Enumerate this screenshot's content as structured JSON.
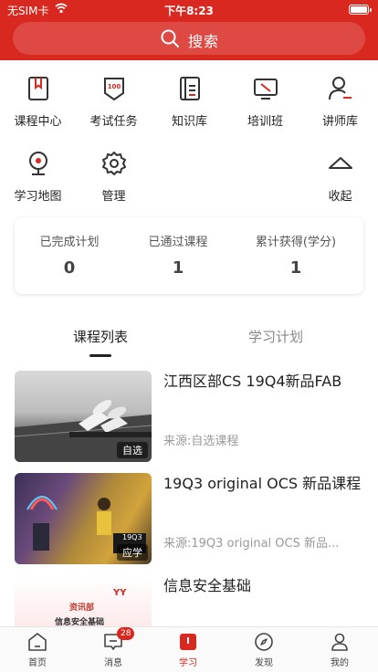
{
  "status_bar": {
    "carrier": "无SIM卡",
    "time": "下午8:23"
  },
  "search": {
    "placeholder": "搜索"
  },
  "menu": [
    {
      "label": "课程中心",
      "icon": "book-icon"
    },
    {
      "label": "考试任务",
      "icon": "exam-badge-icon"
    },
    {
      "label": "知识库",
      "icon": "document-icon"
    },
    {
      "label": "培训班",
      "icon": "monitor-icon"
    },
    {
      "label": "讲师库",
      "icon": "teacher-icon"
    },
    {
      "label": "学习地图",
      "icon": "location-icon"
    },
    {
      "label": "管理",
      "icon": "gear-icon"
    },
    {
      "label": "收起",
      "icon": "chevron-up-icon"
    }
  ],
  "stats": [
    {
      "label": "已完成计划",
      "value": "0"
    },
    {
      "label": "已通过课程",
      "value": "1"
    },
    {
      "label": "累计获得(学分)",
      "value": "1"
    }
  ],
  "tabs": {
    "course_list": "课程列表",
    "study_plan": "学习计划"
  },
  "courses": [
    {
      "title": "江西区部CS 19Q4新品FAB",
      "source": "来源:自选课程",
      "tag": "自选"
    },
    {
      "title": "19Q3 original OCS 新品课程",
      "source": "来源:19Q3 original OCS 新品...",
      "tag": "应学",
      "thumb_text": "19Q3"
    },
    {
      "title": "信息安全基础",
      "source": "",
      "thumb_text_1": "资讯部",
      "thumb_text_2": "信息安全基础"
    }
  ],
  "bottom_nav": [
    {
      "label": "首页"
    },
    {
      "label": "消息",
      "badge": "28"
    },
    {
      "label": "学习"
    },
    {
      "label": "发现"
    },
    {
      "label": "我的"
    }
  ],
  "colors": {
    "brand": "#d8281f"
  }
}
